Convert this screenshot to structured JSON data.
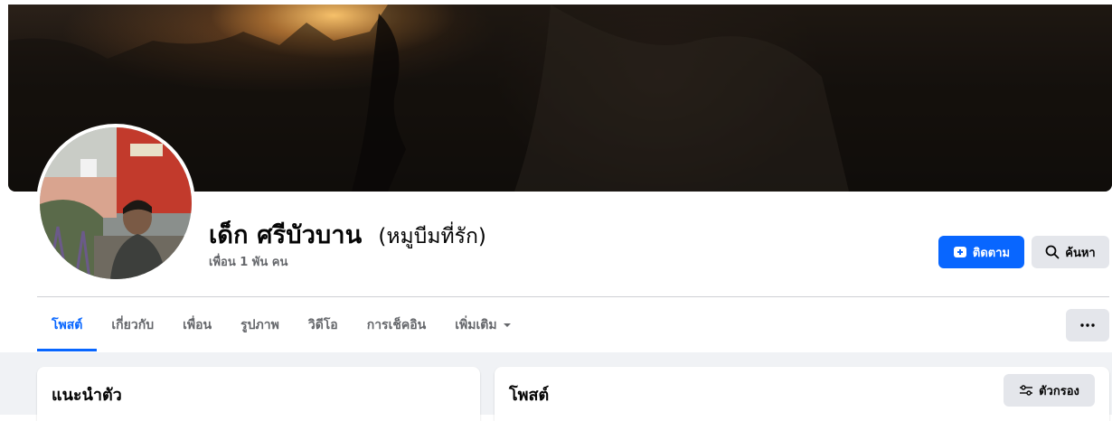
{
  "profile": {
    "name": "เด็ก ศรีบัวบาน",
    "alternate_name": "(หมูบีมที่รัก)",
    "friends_count": "เพื่อน 1 พัน คน"
  },
  "actions": {
    "follow_label": "ติดตาม",
    "search_label": "ค้นหา"
  },
  "tabs": [
    {
      "label": "โพสต์",
      "active": true
    },
    {
      "label": "เกี่ยวกับ"
    },
    {
      "label": "เพื่อน"
    },
    {
      "label": "รูปภาพ"
    },
    {
      "label": "วิดีโอ"
    },
    {
      "label": "การเช็คอิน"
    },
    {
      "label": "เพิ่มเติม"
    }
  ],
  "intro_card": {
    "title": "แนะนำตัว"
  },
  "posts_card": {
    "title": "โพสต์",
    "filter_label": "ตัวกรอง"
  },
  "colors": {
    "accent": "#0866ff",
    "secondary_button": "#e4e6eb",
    "page_background": "#f0f2f5",
    "muted_text": "#65676b"
  },
  "icons": {
    "follow": "follow-plus-icon",
    "search": "search-icon",
    "more_caret": "caret-down-icon",
    "more_menu": "ellipsis-icon",
    "filter": "filter-sliders-icon"
  }
}
